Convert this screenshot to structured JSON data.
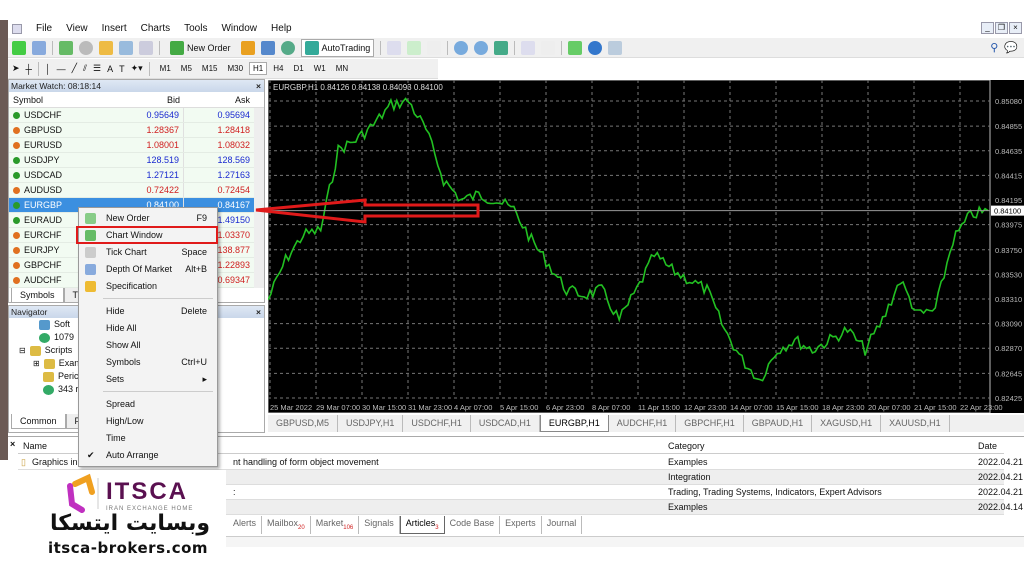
{
  "menu": [
    "File",
    "View",
    "Insert",
    "Charts",
    "Tools",
    "Window",
    "Help"
  ],
  "toolbar": {
    "new_order": "New Order",
    "autotrading": "AutoTrading"
  },
  "timeframes": [
    "M1",
    "M5",
    "M15",
    "M30",
    "H1",
    "H4",
    "D1",
    "W1",
    "MN"
  ],
  "active_timeframe": "H1",
  "market_watch": {
    "title": "Market Watch: 08:18:14",
    "headers": [
      "Symbol",
      "Bid",
      "Ask"
    ],
    "rows": [
      {
        "symbol": "USDCHF",
        "bid": "0.95649",
        "ask": "0.95694",
        "dir": "up"
      },
      {
        "symbol": "GBPUSD",
        "bid": "1.28367",
        "ask": "1.28418",
        "dir": "down"
      },
      {
        "symbol": "EURUSD",
        "bid": "1.08001",
        "ask": "1.08032",
        "dir": "down"
      },
      {
        "symbol": "USDJPY",
        "bid": "128.519",
        "ask": "128.569",
        "dir": "up"
      },
      {
        "symbol": "USDCAD",
        "bid": "1.27121",
        "ask": "1.27163",
        "dir": "up"
      },
      {
        "symbol": "AUDUSD",
        "bid": "0.72422",
        "ask": "0.72454",
        "dir": "down"
      },
      {
        "symbol": "EURGBP",
        "bid": "0.84100",
        "ask": "0.84167",
        "dir": "up",
        "selected": true
      },
      {
        "symbol": "EURAUD",
        "bid": "",
        "ask": "1.49150",
        "dir": "up"
      },
      {
        "symbol": "EURCHF",
        "bid": "",
        "ask": "1.03370",
        "dir": "down"
      },
      {
        "symbol": "EURJPY",
        "bid": "",
        "ask": "138.877",
        "dir": "down"
      },
      {
        "symbol": "GBPCHF",
        "bid": "",
        "ask": "1.22893",
        "dir": "down"
      },
      {
        "symbol": "AUDCHF",
        "bid": "",
        "ask": "0.69347",
        "dir": "down"
      }
    ],
    "tabs": [
      "Symbols",
      "Tic"
    ]
  },
  "navigator": {
    "title": "Navigator",
    "items": [
      "Soft",
      "1079",
      "Scripts",
      "Exan",
      "Peric",
      "343 r"
    ],
    "tabs": [
      "Common",
      "Fa"
    ]
  },
  "context_menu": [
    {
      "label": "New Order",
      "shortcut": "F9",
      "icon": "new-order-icon"
    },
    {
      "label": "Chart Window",
      "shortcut": "",
      "icon": "chart-window-icon",
      "highlighted": true
    },
    {
      "label": "Tick Chart",
      "shortcut": "Space",
      "icon": "tick-chart-icon"
    },
    {
      "label": "Depth Of Market",
      "shortcut": "Alt+B",
      "icon": "depth-icon"
    },
    {
      "label": "Specification",
      "shortcut": "",
      "icon": "specification-icon"
    },
    {
      "label": "Hide",
      "shortcut": "Delete"
    },
    {
      "label": "Hide All",
      "shortcut": ""
    },
    {
      "label": "Show All",
      "shortcut": ""
    },
    {
      "label": "Symbols",
      "shortcut": "Ctrl+U"
    },
    {
      "label": "Sets",
      "shortcut": "▸"
    },
    {
      "label": "Spread",
      "shortcut": ""
    },
    {
      "label": "High/Low",
      "shortcut": ""
    },
    {
      "label": "Time",
      "shortcut": ""
    },
    {
      "label": "Auto Arrange",
      "shortcut": "",
      "checked": true
    }
  ],
  "chart": {
    "header": "EURGBP,H1  0.84126 0.84138 0.84093 0.84100",
    "current_price": "0.84100",
    "price_ticks": [
      "0.85080",
      "0.84855",
      "0.84635",
      "0.84415",
      "0.84195",
      "0.83975",
      "0.83750",
      "0.83530",
      "0.83310",
      "0.83090",
      "0.82870",
      "0.82645",
      "0.82425"
    ],
    "time_ticks": [
      "25 Mar 2022",
      "29 Mar 07:00",
      "30 Mar 15:00",
      "31 Mar 23:00",
      "4 Apr 07:00",
      "5 Apr 15:00",
      "6 Apr 23:00",
      "8 Apr 07:00",
      "11 Apr 15:00",
      "12 Apr 23:00",
      "14 Apr 07:00",
      "15 Apr 15:00",
      "18 Apr 23:00",
      "20 Apr 07:00",
      "21 Apr 15:00",
      "22 Apr 23:00"
    ],
    "line_color": "#22c022",
    "closes": [
      0.83301,
      0.83659,
      0.83882,
      0.83927,
      0.84642,
      0.84731,
      0.84865,
      0.85044,
      0.8508,
      0.84821,
      0.84374,
      0.84195,
      0.8424,
      0.84195,
      0.84106,
      0.83837,
      0.83614,
      0.8339,
      0.83346,
      0.8339,
      0.83122,
      0.8339,
      0.83703,
      0.83569,
      0.8348,
      0.8339,
      0.83033,
      0.82765,
      0.82586,
      0.82854,
      0.82943,
      0.82854,
      0.82943,
      0.83033,
      0.82854,
      0.83122,
      0.8348,
      0.83167,
      0.83212,
      0.83837,
      0.84061,
      0.841
    ]
  },
  "chart_tabs": [
    "GBPUSD,M5",
    "USDJPY,H1",
    "USDCHF,H1",
    "USDCAD,H1",
    "EURGBP,H1",
    "AUDCHF,H1",
    "GBPCHF,H1",
    "GBPAUD,H1",
    "XAGUSD,H1",
    "XAUUSD,H1"
  ],
  "active_chart_tab": "EURGBP,H1",
  "toolbox": {
    "headers": {
      "name": "Name",
      "category": "Category",
      "date": "Date"
    },
    "rows": [
      {
        "name": "Graphics in",
        "desc": "nt handling of form object movement",
        "category": "Examples",
        "date": "2022.04.21"
      },
      {
        "name": "",
        "desc": "",
        "category": "Integration",
        "date": "2022.04.21"
      },
      {
        "name": "",
        "desc": ":",
        "category": "Trading, Trading Systems, Indicators, Expert Advisors",
        "date": "2022.04.21"
      },
      {
        "name": "",
        "desc": "",
        "category": "Examples",
        "date": "2022.04.14"
      }
    ],
    "tabs": [
      {
        "label": "Alerts"
      },
      {
        "label": "Mailbox",
        "badge": "20"
      },
      {
        "label": "Market",
        "badge": "106"
      },
      {
        "label": "Signals"
      },
      {
        "label": "Articles",
        "badge": "3",
        "active": true
      },
      {
        "label": "Code Base"
      },
      {
        "label": "Experts"
      },
      {
        "label": "Journal"
      }
    ]
  },
  "logo": {
    "brand": "ITSCA",
    "tagline": "IRAN EXCHANGE HOME",
    "persian": "وبسایت ایتسکا",
    "url": "itsca-brokers.com"
  },
  "colors": {
    "arrow": "#e01a1a",
    "selection": "#3b8fe0",
    "chart_bg": "#000000"
  }
}
